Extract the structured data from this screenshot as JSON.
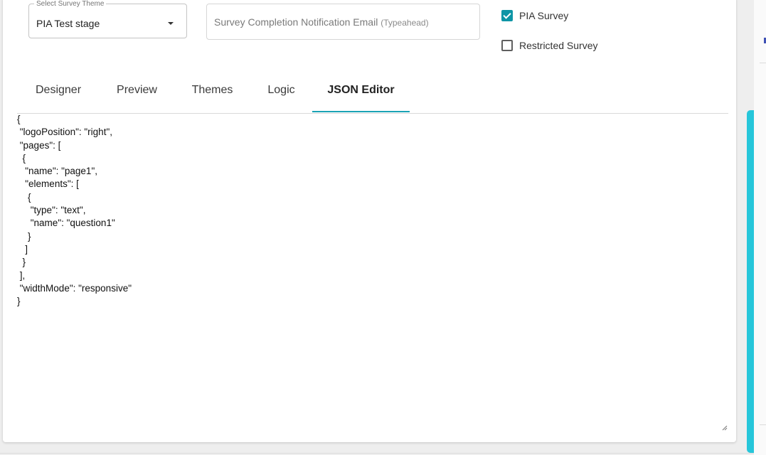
{
  "theme_select": {
    "label": "Select Survey Theme",
    "value": "PIA Test stage"
  },
  "email_field": {
    "placeholder": "Survey Completion Notification Email",
    "hint": "(Typeahead)"
  },
  "checkboxes": {
    "pia_survey": {
      "label": "PIA Survey",
      "checked": true
    },
    "restricted_survey": {
      "label": "Restricted Survey",
      "checked": false
    }
  },
  "tabs": [
    {
      "label": "Designer",
      "active": false
    },
    {
      "label": "Preview",
      "active": false
    },
    {
      "label": "Themes",
      "active": false
    },
    {
      "label": "Logic",
      "active": false
    },
    {
      "label": "JSON Editor",
      "active": true
    }
  ],
  "json_editor": {
    "content": "{\n \"logoPosition\": \"right\",\n \"pages\": [\n  {\n   \"name\": \"page1\",\n   \"elements\": [\n    {\n     \"type\": \"text\",\n     \"name\": \"question1\"\n    }\n   ]\n  }\n ],\n \"widthMode\": \"responsive\"\n}"
  },
  "colors": {
    "accent": "#1aa3b5",
    "checkbox_checked": "#0e95a6",
    "scroll_accent": "#26c6da"
  }
}
